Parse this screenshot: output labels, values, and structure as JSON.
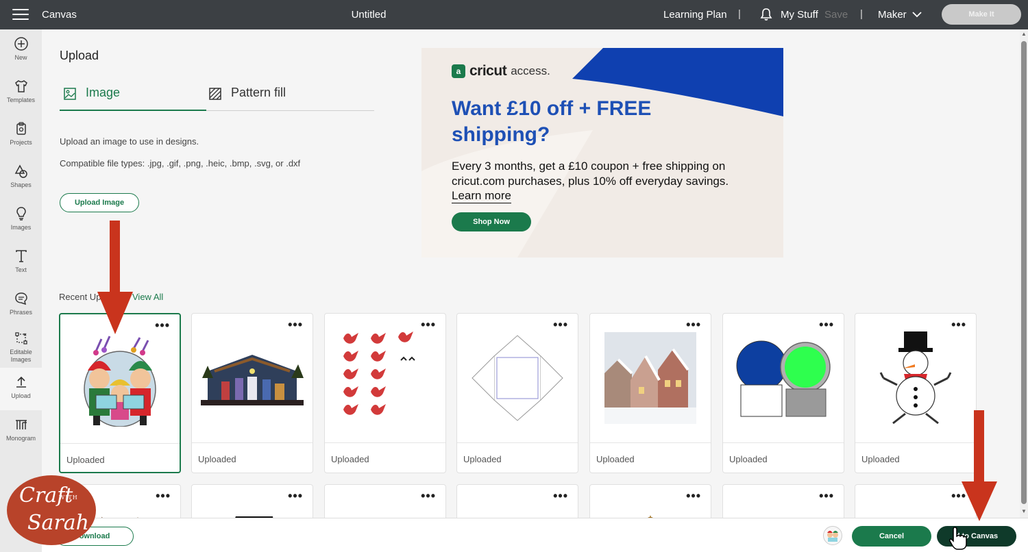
{
  "topbar": {
    "app_title": "Canvas",
    "doc_title": "Untitled",
    "learning_plan": "Learning Plan",
    "divider": "|",
    "my_stuff": "My Stuff",
    "save": "Save",
    "machine": "Maker",
    "make_it": "Make It"
  },
  "sidebar": {
    "items": [
      {
        "label": "New",
        "icon": "plus-circle-icon"
      },
      {
        "label": "Templates",
        "icon": "shirt-icon"
      },
      {
        "label": "Projects",
        "icon": "projects-icon"
      },
      {
        "label": "Shapes",
        "icon": "shapes-icon"
      },
      {
        "label": "Images",
        "icon": "lightbulb-icon"
      },
      {
        "label": "Text",
        "icon": "text-icon"
      },
      {
        "label": "Phrases",
        "icon": "speech-bubble-icon"
      },
      {
        "label": "Editable Images",
        "icon": "editable-images-icon"
      },
      {
        "label": "Upload",
        "icon": "upload-icon"
      },
      {
        "label": "Monogram",
        "icon": "monogram-icon"
      }
    ]
  },
  "upload": {
    "heading": "Upload",
    "tabs": [
      {
        "label": "Image",
        "active": true
      },
      {
        "label": "Pattern fill",
        "active": false
      }
    ],
    "description": "Upload an image to use in designs.",
    "file_types": "Compatible file types: .jpg, .gif, .png, .heic, .bmp, .svg, or .dxf",
    "upload_button": "Upload Image"
  },
  "ad": {
    "logo_badge": "a",
    "logo_brand": "cricut",
    "logo_suffix": "access.",
    "headline": "Want £10 off + FREE shipping?",
    "body": "Every 3 months, get a £10 coupon + free shipping on cricut.com purchases, plus 10% off everyday savings.",
    "learn_more": "Learn more",
    "shop_now": "Shop Now",
    "colors": {
      "blue": "#0f40b0",
      "green": "#1b7a4c",
      "bg": "#f1ebe6"
    }
  },
  "recent": {
    "label": "Recent Uploads",
    "label_visible": "Recent Uplo",
    "view_all": "View All",
    "more_glyph": "•••",
    "items": [
      {
        "status": "Uploaded",
        "thumb": "carolers",
        "selected": true
      },
      {
        "status": "Uploaded",
        "thumb": "nativity",
        "selected": false
      },
      {
        "status": "Uploaded",
        "thumb": "red-birds",
        "selected": false
      },
      {
        "status": "Uploaded",
        "thumb": "envelope-template",
        "selected": false
      },
      {
        "status": "Uploaded",
        "thumb": "winter-village",
        "selected": false
      },
      {
        "status": "Uploaded",
        "thumb": "snow-globe",
        "selected": false
      },
      {
        "status": "Uploaded",
        "thumb": "snowman",
        "selected": false
      }
    ]
  },
  "bottombar": {
    "download": "Download",
    "download_visible": "ownload",
    "cancel": "Cancel",
    "add_to_canvas": "Add to Canvas",
    "add_to_canvas_visible": "d to Canvas"
  },
  "watermark": {
    "line1": "Craft",
    "line2": "WITH",
    "line3": "Sarah",
    "color": "#b8432a"
  },
  "accent_color": "#1b7a4c",
  "arrow_color": "#c9341d"
}
